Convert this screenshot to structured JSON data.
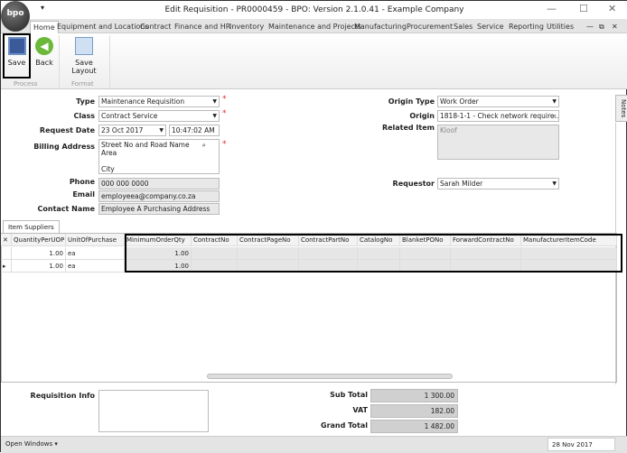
{
  "window": {
    "title": "Edit Requisition - PR0000459 - BPO: Version 2.1.0.41 - Example Company",
    "logo": "bpo"
  },
  "tabs": [
    "Home",
    "Equipment and Locations",
    "Contract",
    "Finance and HR",
    "Inventory",
    "Maintenance and Projects",
    "Manufacturing",
    "Procurement",
    "Sales",
    "Service",
    "Reporting",
    "Utilities"
  ],
  "ribbon": {
    "save": "Save",
    "back": "Back",
    "save_layout": "Save Layout",
    "group_process": "Process",
    "group_format": "Format"
  },
  "form": {
    "type_label": "Type",
    "type": "Maintenance Requisition",
    "class_label": "Class",
    "class": "Contract Service",
    "request_date_label": "Request Date",
    "request_date": "23 Oct 2017",
    "request_time": "10:47:02 AM",
    "billing_label": "Billing Address",
    "billing_lines": [
      "Street No and Road Name",
      "Area",
      "",
      "City"
    ],
    "phone_label": "Phone",
    "phone": "000 000 0000",
    "email_label": "Email",
    "email": "employeea@company.co.za",
    "contact_label": "Contact Name",
    "contact": "Employee A Purchasing Address",
    "origin_type_label": "Origin Type",
    "origin_type": "Work Order",
    "origin_label": "Origin",
    "origin": "1818-1-1 - Check network require...",
    "related_label": "Related Item",
    "related": "Kloof",
    "requestor_label": "Requestor",
    "requestor": "Sarah Milder",
    "notes_tab": "Notes"
  },
  "grid": {
    "tab": "Item Suppliers",
    "columns": [
      "QuantityPerUOP",
      "UnitOfPurchase",
      "MinimumOrderQty",
      "ContractNo",
      "ContractPageNo",
      "ContractPartNo",
      "CatalogNo",
      "BlanketPONo",
      "ForwardContractNo",
      "ManufacturerItemCode"
    ],
    "rows": [
      [
        "1.00",
        "ea",
        "1.00",
        "",
        "",
        "",
        "",
        "",
        "",
        ""
      ],
      [
        "1.00",
        "ea",
        "1.00",
        "",
        "",
        "",
        "",
        "",
        "",
        ""
      ]
    ]
  },
  "footer": {
    "req_info_label": "Requisition Info",
    "req_info": "",
    "subtotal_label": "Sub Total",
    "subtotal": "1 300.00",
    "vat_label": "VAT",
    "vat": "182.00",
    "grand_label": "Grand Total",
    "grand": "1 482.00"
  },
  "status": {
    "open_windows": "Open Windows ▾",
    "date": "28 Nov 2017"
  }
}
